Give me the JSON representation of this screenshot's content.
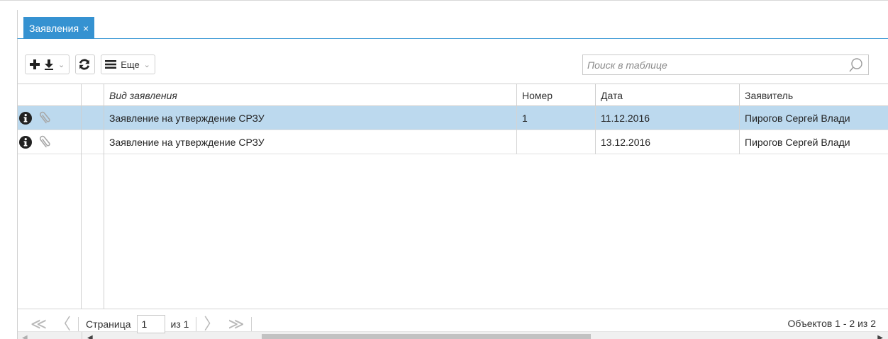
{
  "tab": {
    "label": "Заявления",
    "close": "×"
  },
  "toolbar": {
    "more_label": "Еще"
  },
  "search": {
    "placeholder": "Поиск в таблице"
  },
  "table": {
    "columns": [
      "Вид заявления",
      "Номер",
      "Дата",
      "Заявитель"
    ],
    "rows": [
      {
        "type": "Заявление на утверждение СРЗУ",
        "number": "1",
        "date": "11.12.2016",
        "applicant": "Пирогов Сергей Влади",
        "selected": true
      },
      {
        "type": "Заявление на утверждение СРЗУ",
        "number": "",
        "date": "13.12.2016",
        "applicant": "Пирогов Сергей Влади",
        "selected": false
      }
    ]
  },
  "pager": {
    "page_label": "Страница",
    "page_value": "1",
    "of_label": "из 1",
    "count_label": "Объектов 1 - 2 из 2"
  },
  "colors": {
    "accent": "#3592d1",
    "selected_row": "#bcd9ee"
  }
}
